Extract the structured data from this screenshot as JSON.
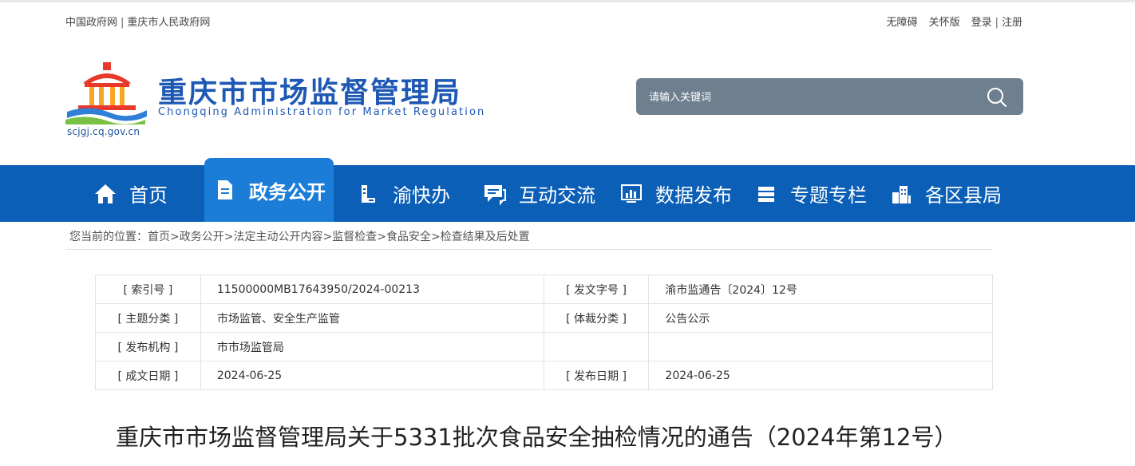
{
  "topbar": {
    "links_left": [
      "中国政府网",
      "重庆市人民政府网"
    ],
    "separator": "|",
    "links_right": [
      "无障碍",
      "关怀版"
    ],
    "login": "登录",
    "register": "注册"
  },
  "header": {
    "title_cn": "重庆市市场监督管理局",
    "title_en": "Chongqing  Administration for Market Regulation",
    "domain": "scjgj.cq.gov.cn",
    "search_placeholder": "请输入关键词"
  },
  "colors": {
    "brand_blue": "#1d58b4",
    "nav_bg": "#0b5fb6",
    "nav_active": "#1b7dd8",
    "search_bg": "#6e7f8f"
  },
  "nav": {
    "items": [
      {
        "label": "首页",
        "icon": "home-icon"
      },
      {
        "label": "政务公开",
        "icon": "document-icon",
        "active": true
      },
      {
        "label": "渝快办",
        "icon": "book-icon"
      },
      {
        "label": "互动交流",
        "icon": "chat-icon"
      },
      {
        "label": "数据发布",
        "icon": "data-chart-icon"
      },
      {
        "label": "专题专栏",
        "icon": "stack-icon"
      },
      {
        "label": "各区县局",
        "icon": "building-icon"
      }
    ]
  },
  "breadcrumb": {
    "prefix": "您当前的位置：",
    "items": [
      "首页",
      "政务公开",
      "法定主动公开内容",
      "监督检查",
      "食品安全",
      "检查结果及后处置"
    ],
    "separator": ">"
  },
  "meta": {
    "rows": [
      {
        "l1": "[ 索引号 ]",
        "v1": "11500000MB17643950/2024-00213",
        "l2": "[ 发文字号 ]",
        "v2": "渝市监通告〔2024〕12号"
      },
      {
        "l1": "[ 主题分类 ]",
        "v1": "市场监管、安全生产监管",
        "l2": "[ 体裁分类 ]",
        "v2": "公告公示"
      },
      {
        "l1": "[ 发布机构 ]",
        "v1": "市市场监管局",
        "l2": "",
        "v2": ""
      },
      {
        "l1": "[ 成文日期 ]",
        "v1": "2024-06-25",
        "l2": "[ 发布日期 ]",
        "v2": "2024-06-25"
      }
    ]
  },
  "article": {
    "title": "重庆市市场监督管理局关于5331批次食品安全抽检情况的通告（2024年第12号）"
  }
}
